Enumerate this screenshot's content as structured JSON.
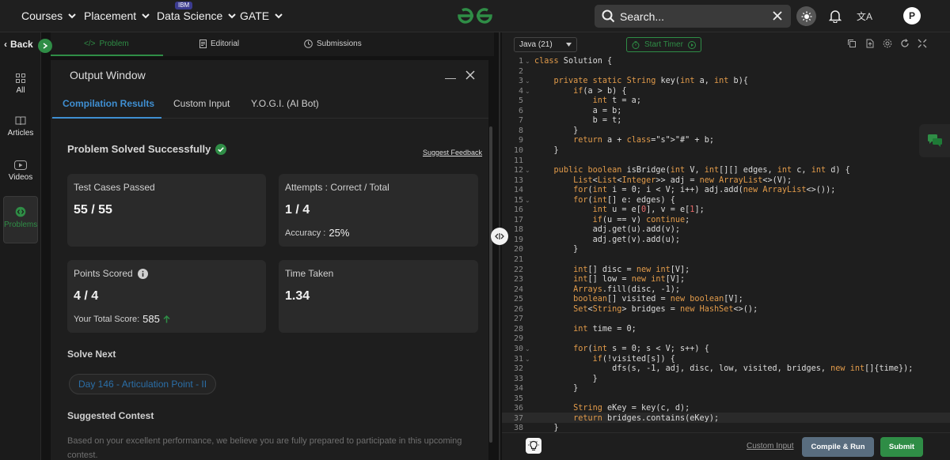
{
  "nav": {
    "items": [
      {
        "label": "Courses"
      },
      {
        "label": "Placement"
      },
      {
        "label": "Data Science",
        "badge": "IBM"
      },
      {
        "label": "GATE"
      }
    ],
    "search_placeholder": "Search...",
    "avatar_initial": "P",
    "accent": "#2f8d46"
  },
  "sidebar": {
    "back_label": "Back",
    "items": [
      {
        "label": "All",
        "icon": "grid-icon"
      },
      {
        "label": "Articles",
        "icon": "book-icon"
      },
      {
        "label": "Videos",
        "icon": "play-icon"
      },
      {
        "label": "Problems",
        "icon": "code-icon",
        "active": true
      }
    ]
  },
  "problem_tabs": [
    {
      "label": "Problem",
      "icon": "code-icon",
      "active": true
    },
    {
      "label": "Editorial",
      "icon": "document-icon"
    },
    {
      "label": "Submissions",
      "icon": "clock-icon"
    }
  ],
  "output": {
    "title": "Output Window",
    "tabs": [
      {
        "label": "Compilation Results",
        "active": true
      },
      {
        "label": "Custom Input"
      },
      {
        "label": "Y.O.G.I. (AI Bot)"
      }
    ],
    "status": "Problem Solved Successfully",
    "feedback_link": "Suggest Feedback",
    "cards": {
      "test_cases": {
        "label": "Test Cases Passed",
        "value": "55 / 55"
      },
      "attempts": {
        "label": "Attempts : Correct / Total",
        "value": "1 / 4",
        "accuracy_label": "Accuracy :",
        "accuracy_value": "25%"
      },
      "points": {
        "label": "Points Scored",
        "value": "4 / 4",
        "total_label": "Your Total Score:",
        "total_value": "585"
      },
      "time": {
        "label": "Time Taken",
        "value": "1.34"
      }
    },
    "solve_next_title": "Solve Next",
    "solve_next_item": "Day 146 - Articulation Point - II",
    "contest_title": "Suggested Contest",
    "contest_text": "Based on your excellent performance, we believe you are fully prepared to participate in this upcoming contest."
  },
  "editor": {
    "language": "Java (21)",
    "timer_label": "Start Timer",
    "custom_input_link": "Custom Input",
    "compile_label": "Compile & Run",
    "submit_label": "Submit",
    "lines": [
      "class Solution {",
      "",
      "    private static String key(int a, int b){",
      "        if(a > b) {",
      "            int t = a;",
      "            a = b;",
      "            b = t;",
      "        }",
      "        return a + \"#\" + b;",
      "    }",
      "",
      "    public boolean isBridge(int V, int[][] edges, int c, int d) {",
      "        List<List<Integer>> adj = new ArrayList<>(V);",
      "        for(int i = 0; i < V; i++) adj.add(new ArrayList<>());",
      "        for(int[] e: edges) {",
      "            int u = e[0], v = e[1];",
      "            if(u == v) continue;",
      "            adj.get(u).add(v);",
      "            adj.get(v).add(u);",
      "        }",
      "",
      "        int[] disc = new int[V];",
      "        int[] low = new int[V];",
      "        Arrays.fill(disc, -1);",
      "        boolean[] visited = new boolean[V];",
      "        Set<String> bridges = new HashSet<>();",
      "",
      "        int time = 0;",
      "",
      "        for(int s = 0; s < V; s++) {",
      "            if(!visited[s]) {",
      "                dfs(s, -1, adj, disc, low, visited, bridges, new int[]{time});",
      "            }",
      "        }",
      "",
      "        String eKey = key(c, d);",
      "        return bridges.contains(eKey);",
      "    }"
    ]
  }
}
